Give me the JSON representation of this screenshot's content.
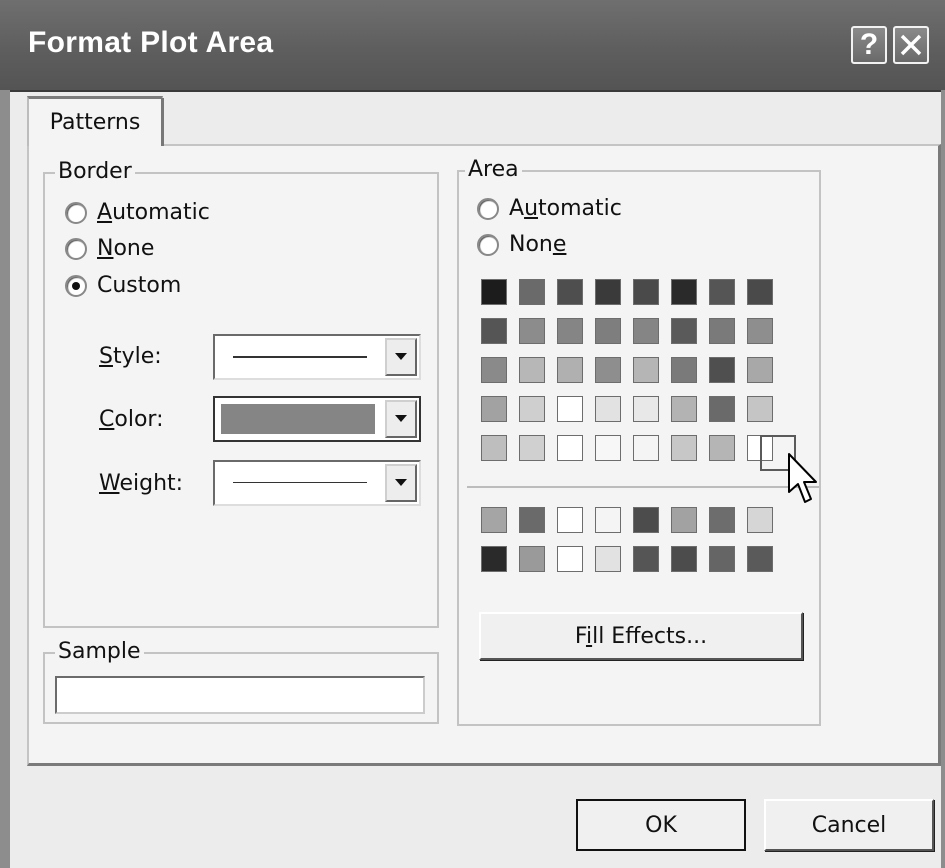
{
  "window": {
    "title": "Format Plot Area",
    "help_glyph": "?",
    "close_icon": "close-icon"
  },
  "tabs": [
    {
      "label": "Patterns",
      "selected": true
    }
  ],
  "border": {
    "group_label": "Border",
    "options": [
      {
        "label": "Automatic",
        "checked": false
      },
      {
        "label": "None",
        "checked": false
      },
      {
        "label": "Custom",
        "checked": true
      }
    ],
    "style_label": "Style:",
    "color_label": "Color:",
    "weight_label": "Weight:",
    "color_value": "#858585"
  },
  "sample": {
    "group_label": "Sample"
  },
  "area": {
    "group_label": "Area",
    "options": [
      {
        "label": "Automatic",
        "checked": false
      },
      {
        "label": "None",
        "checked": false
      }
    ],
    "palette": [
      [
        "#1c1c1c",
        "#6a6a6a",
        "#4e4e4e",
        "#3a3a3a",
        "#4a4a4a",
        "#2a2a2a",
        "#555555",
        "#4a4a4a"
      ],
      [
        "#555555",
        "#8c8c8c",
        "#858585",
        "#7e7e7e",
        "#858585",
        "#5a5a5a",
        "#7a7a7a",
        "#8e8e8e"
      ],
      [
        "#8a8a8a",
        "#b7b7b7",
        "#b0b0b0",
        "#8e8e8e",
        "#b5b5b5",
        "#7a7a7a",
        "#4f4f4f",
        "#a8a8a8"
      ],
      [
        "#a2a2a2",
        "#cfcfcf",
        "#ffffff",
        "#e2e2e2",
        "#e8e8e8",
        "#b3b3b3",
        "#6a6a6a",
        "#c5c5c5"
      ],
      [
        "#bebebe",
        "#d0d0d0",
        "#ffffff",
        "#f7f7f7",
        "#f4f4f4",
        "#c7c7c7",
        "#b5b5b5",
        "#ffffff"
      ]
    ],
    "extra_palette": [
      [
        "#a5a5a5",
        "#6a6a6a",
        "#ffffff",
        "#f4f4f4",
        "#4c4c4c",
        "#a2a2a2",
        "#6d6d6d",
        "#d6d6d6"
      ],
      [
        "#2a2a2a",
        "#9a9a9a",
        "#ffffff",
        "#e2e2e2",
        "#555555",
        "#4c4c4c",
        "#656565",
        "#5a5a5a"
      ]
    ],
    "fill_effects_label": "Fill Effects..."
  },
  "buttons": {
    "ok": "OK",
    "cancel": "Cancel"
  }
}
